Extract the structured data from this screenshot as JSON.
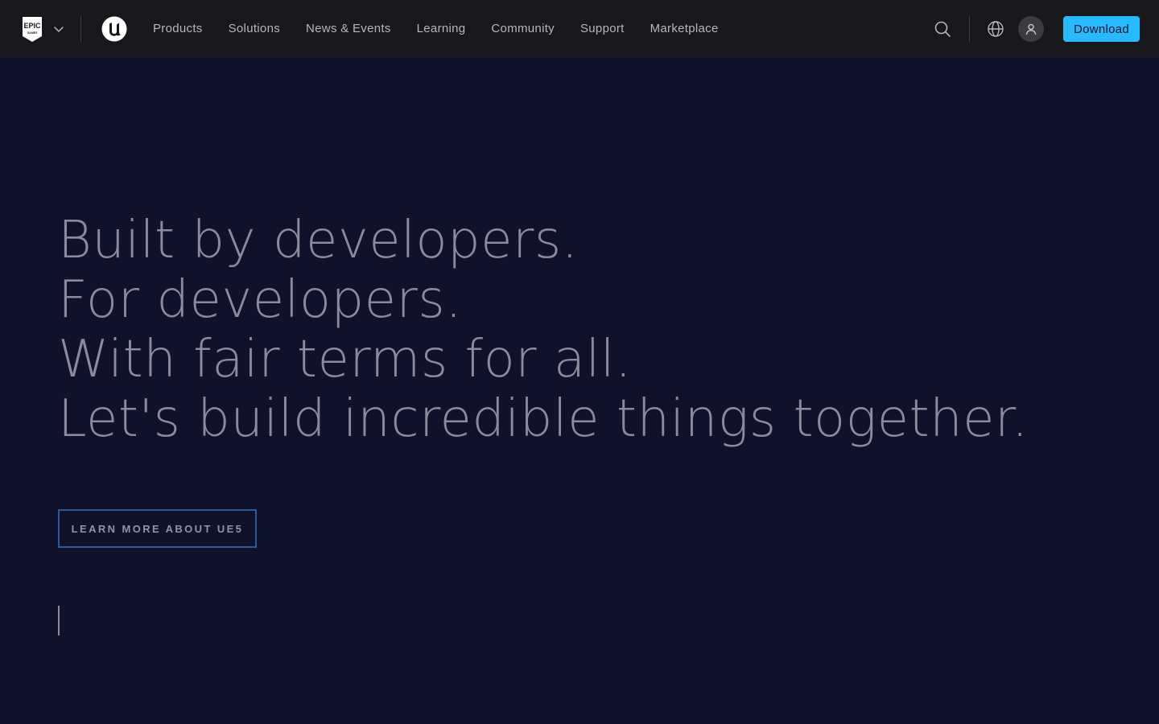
{
  "header": {
    "epic_logo_text": "EPIC GAMES",
    "nav_links": [
      "Products",
      "Solutions",
      "News & Events",
      "Learning",
      "Community",
      "Support",
      "Marketplace"
    ],
    "download_label": "Download",
    "accent_color": "#26bbff"
  },
  "hero": {
    "lines": [
      "Built by developers.",
      "For developers.",
      "With fair terms for all.",
      "Let's build incredible things together."
    ],
    "cta_label": "LEARN MORE ABOUT UE5"
  },
  "icons": [
    "epic-games-logo",
    "chevron-down-icon",
    "unreal-engine-logo",
    "search-icon",
    "globe-icon",
    "user-icon"
  ],
  "colors": {
    "background": "#10112a",
    "nav_background": "#18181c",
    "hero_text": "#8a8b9c",
    "cta_border": "#2a5a9a"
  }
}
